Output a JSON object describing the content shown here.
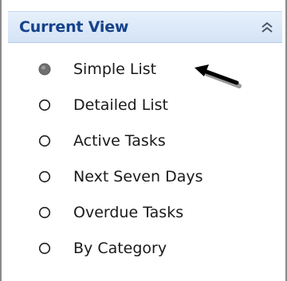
{
  "panel": {
    "title": "Current View",
    "collapse_icon": "double-chevron-up-icon",
    "accent_color": "#15428b",
    "header_bg": "#dde8f7"
  },
  "views": [
    {
      "label": "Simple List",
      "selected": true
    },
    {
      "label": "Detailed List",
      "selected": false
    },
    {
      "label": "Active Tasks",
      "selected": false
    },
    {
      "label": "Next Seven Days",
      "selected": false
    },
    {
      "label": "Overdue Tasks",
      "selected": false
    },
    {
      "label": "By Category",
      "selected": false
    }
  ],
  "annotation": {
    "arrow_icon": "pointer-arrow-icon",
    "color": "#000000"
  }
}
